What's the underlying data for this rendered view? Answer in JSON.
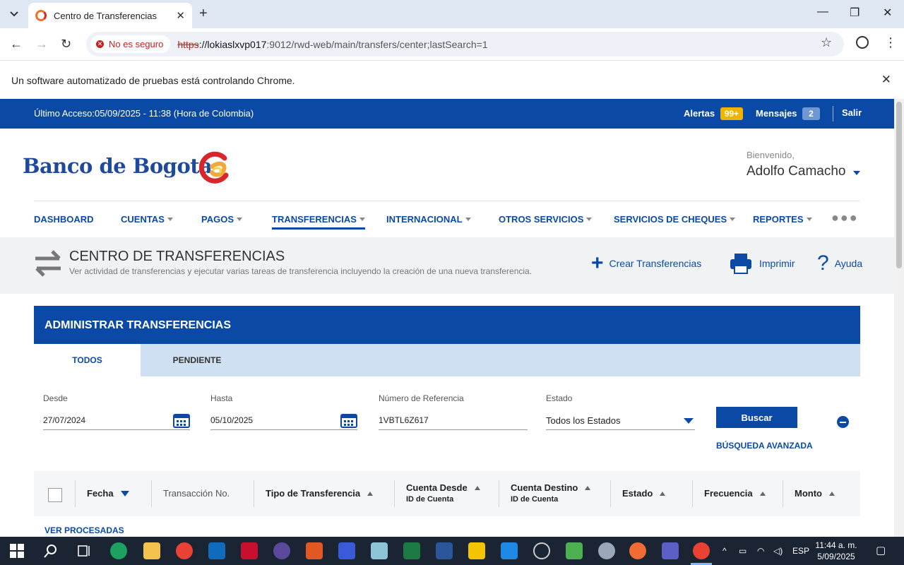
{
  "browser": {
    "tab_title": "Centro de Transferencias",
    "security_label": "No es seguro",
    "url_scheme": "https",
    "url_host": "://lokiaslxvp017",
    "url_rest": ":9012/rwd-web/main/transfers/center;lastSearch=1",
    "infobar_text": "Un software automatizado de pruebas está controlando Chrome."
  },
  "topbar": {
    "last_access": "Último Acceso:05/09/2025 - 11:38 (Hora de Colombia)",
    "alerts_label": "Alertas",
    "alerts_count": "99+",
    "messages_label": "Mensajes",
    "messages_count": "2",
    "logout_label": "Salir"
  },
  "header": {
    "logo_text": "Banco de Bogotá",
    "welcome_label": "Bienvenido,",
    "user_name": "Adolfo Camacho"
  },
  "nav": {
    "items": [
      {
        "label": "DASHBOARD"
      },
      {
        "label": "CUENTAS"
      },
      {
        "label": "PAGOS"
      },
      {
        "label": "TRANSFERENCIAS"
      },
      {
        "label": "INTERNACIONAL"
      },
      {
        "label": "OTROS SERVICIOS"
      },
      {
        "label": "SERVICIOS DE CHEQUES"
      },
      {
        "label": "REPORTES"
      }
    ],
    "active": "TRANSFERENCIAS"
  },
  "page": {
    "title": "CENTRO DE TRANSFERENCIAS",
    "subtitle": "Ver actividad de transferencias y ejecutar varias tareas de transferencia incluyendo la creación de una nueva transferencia.",
    "actions": {
      "create": "Crear Transferencias",
      "print": "Imprimir",
      "help": "Ayuda"
    }
  },
  "panel": {
    "title": "ADMINISTRAR TRANSFERENCIAS",
    "tabs": [
      {
        "label": "TODOS"
      },
      {
        "label": "PENDIENTE"
      }
    ],
    "filters": {
      "from_label": "Desde",
      "from_value": "27/07/2024",
      "to_label": "Hasta",
      "to_value": "05/10/2025",
      "ref_label": "Número de Referencia",
      "ref_value": "1VBTL6Z617",
      "status_label": "Estado",
      "status_value": "Todos los Estados",
      "search_button": "Buscar",
      "advanced_link": "BÚSQUEDA AVANZADA"
    },
    "columns": {
      "date": "Fecha",
      "transaction": "Transacción No.",
      "type": "Tipo de Transferencia",
      "from": "Cuenta Desde",
      "from_sub": "ID de Cuenta",
      "to": "Cuenta Destino",
      "to_sub": "ID de Cuenta",
      "status": "Estado",
      "frequency": "Frecuencia",
      "amount": "Monto"
    },
    "processed_link": "VER PROCESADAS"
  },
  "taskbar": {
    "language": "ESP",
    "time": "11:44 a. m.",
    "date": "5/09/2025"
  },
  "colors": {
    "brand_blue": "#0a4aa6",
    "alert_badge": "#f0b400",
    "tab_active_bg": "#ffffff",
    "tab_strip_bg": "#cfe0f3"
  }
}
